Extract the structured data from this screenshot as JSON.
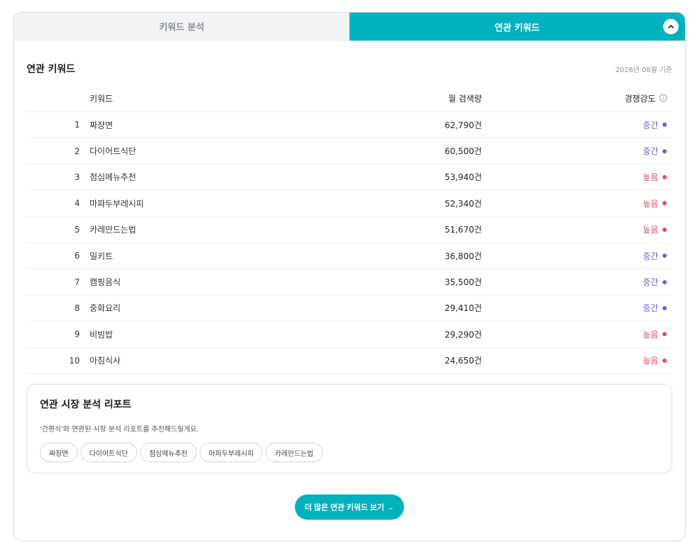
{
  "tabs": [
    {
      "label": "키워드 분석",
      "active": false
    },
    {
      "label": "연관 키워드",
      "active": true
    }
  ],
  "section": {
    "title": "연관 키워드",
    "as_of": "2026년 08월 기준"
  },
  "table": {
    "headers": {
      "keyword": "키워드",
      "volume": "월 검색량",
      "competition": "경쟁강도"
    },
    "rows": [
      {
        "rank": "1",
        "keyword": "짜장면",
        "volume": "62,790건",
        "competition": "중간",
        "level": "mid"
      },
      {
        "rank": "2",
        "keyword": "다이어트식단",
        "volume": "60,500건",
        "competition": "중간",
        "level": "mid"
      },
      {
        "rank": "3",
        "keyword": "점심메뉴추천",
        "volume": "53,940건",
        "competition": "높음",
        "level": "high"
      },
      {
        "rank": "4",
        "keyword": "마파두부레시피",
        "volume": "52,340건",
        "competition": "높음",
        "level": "high"
      },
      {
        "rank": "5",
        "keyword": "카레만드는법",
        "volume": "51,670건",
        "competition": "높음",
        "level": "high"
      },
      {
        "rank": "6",
        "keyword": "밀키트",
        "volume": "36,800건",
        "competition": "중간",
        "level": "mid"
      },
      {
        "rank": "7",
        "keyword": "캠핑음식",
        "volume": "35,500건",
        "competition": "중간",
        "level": "mid"
      },
      {
        "rank": "8",
        "keyword": "중화요리",
        "volume": "29,410건",
        "competition": "중간",
        "level": "mid"
      },
      {
        "rank": "9",
        "keyword": "비빔밥",
        "volume": "29,290건",
        "competition": "높음",
        "level": "high"
      },
      {
        "rank": "10",
        "keyword": "아침식사",
        "volume": "24,650건",
        "competition": "높음",
        "level": "high"
      }
    ]
  },
  "report": {
    "title": "연관 시장 분석 리포트",
    "description": "'간편식'와 연관된 시장 분석 리포트를 추천해드릴게요.",
    "chips": [
      "짜장면",
      "다이어트식단",
      "점심메뉴추천",
      "마파두부레시피",
      "카레만드는법"
    ]
  },
  "more_button": {
    "label": "더 많은 연관 키워드 보기 →"
  },
  "colors": {
    "accent": "#00b2bd",
    "mid": "#6b63d6",
    "high": "#e0495a"
  }
}
